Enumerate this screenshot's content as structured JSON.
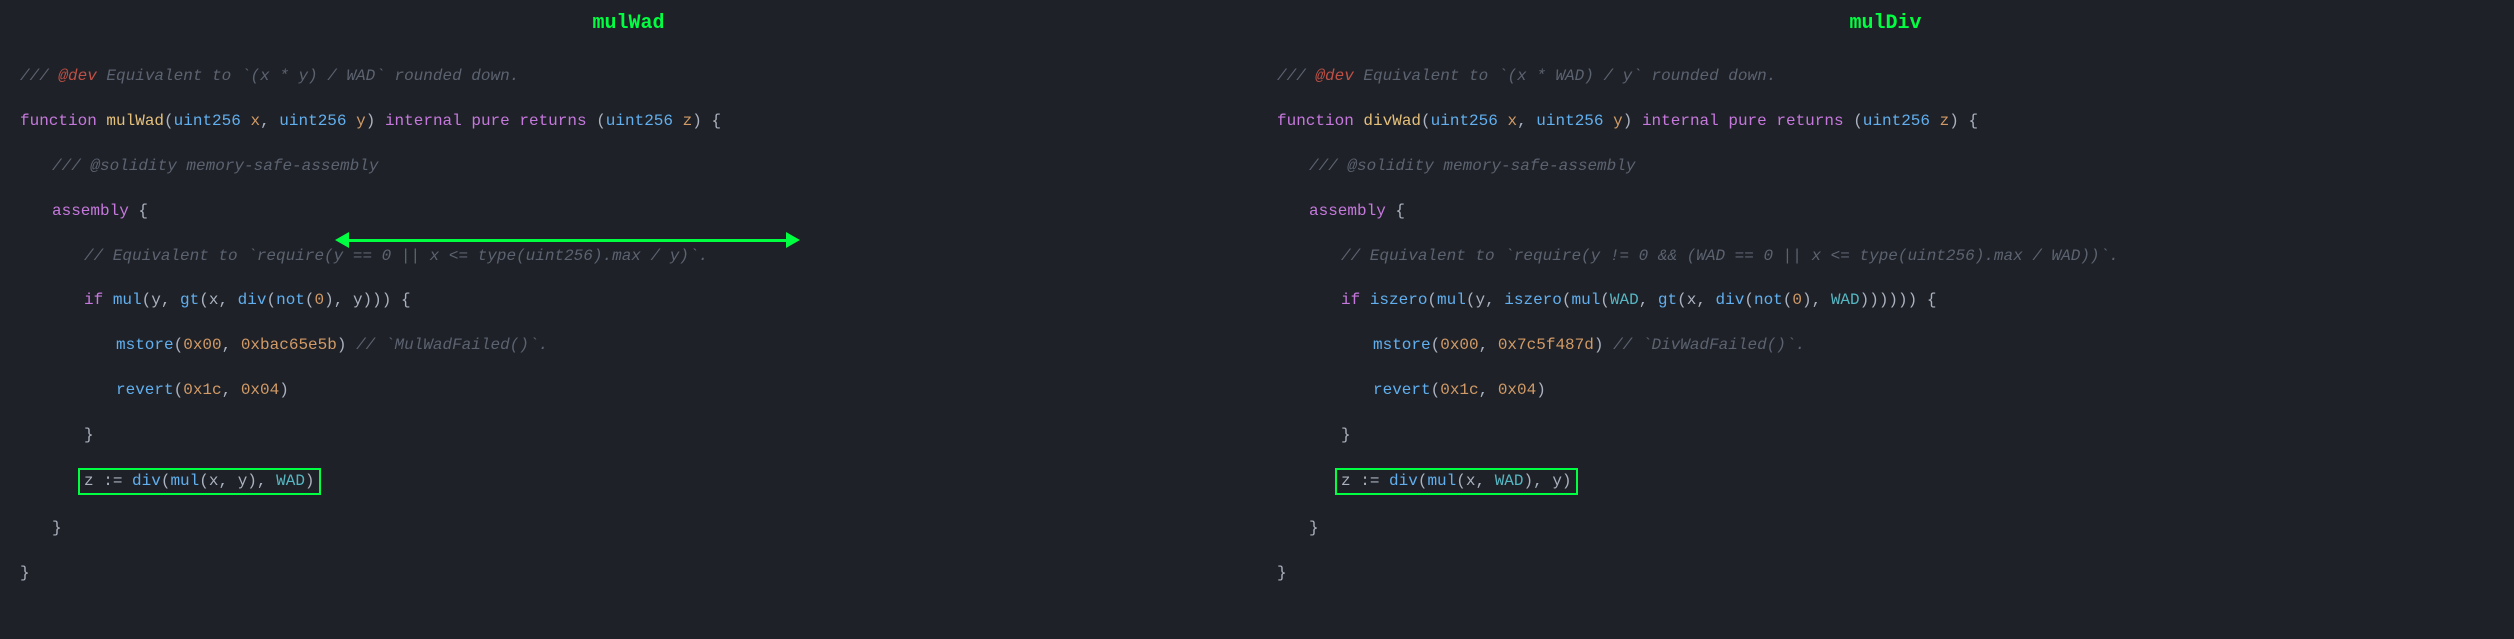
{
  "left": {
    "title": "mulWad",
    "devcomment_prefix": "/// ",
    "devtag": "@dev",
    "devcomment_text": " Equivalent to `(x * y) / WAD` rounded down.",
    "fn_kw": "function",
    "fn_name": "mulWad",
    "param1_type": "uint256",
    "param1_name": "x",
    "param2_type": "uint256",
    "param2_name": "y",
    "modifiers": "internal pure returns",
    "ret_type": "uint256",
    "ret_name": "z",
    "inline_comment1": "/// @solidity memory-safe-assembly",
    "asm_kw": "assembly",
    "require_comment": "// Equivalent to `require(y == 0 || x <= type(uint256).max / y)`.",
    "if_kw": "if",
    "mul_fn": "mul",
    "gt_fn": "gt",
    "div_fn": "div",
    "not_fn": "not",
    "zero": "0",
    "yvar": "y",
    "xvar": "x",
    "mstore_fn": "mstore",
    "mstore_arg1": "0x00",
    "mstore_arg2": "0xbac65e5b",
    "mstore_comment": "// `MulWadFailed()`.",
    "revert_fn": "revert",
    "revert_arg1": "0x1c",
    "revert_arg2": "0x04",
    "assign_var": "z",
    "assign_op": ":=",
    "wad": "WAD"
  },
  "right": {
    "title": "mulDiv",
    "devcomment_prefix": "/// ",
    "devtag": "@dev",
    "devcomment_text": " Equivalent to `(x * WAD) / y` rounded down.",
    "fn_kw": "function",
    "fn_name": "divWad",
    "param1_type": "uint256",
    "param1_name": "x",
    "param2_type": "uint256",
    "param2_name": "y",
    "modifiers": "internal pure returns",
    "ret_type": "uint256",
    "ret_name": "z",
    "inline_comment1": "/// @solidity memory-safe-assembly",
    "asm_kw": "assembly",
    "require_comment": "// Equivalent to `require(y != 0 && (WAD == 0 || x <= type(uint256).max / WAD))`.",
    "if_kw": "if",
    "iszero_fn": "iszero",
    "mul_fn": "mul",
    "gt_fn": "gt",
    "div_fn": "div",
    "not_fn": "not",
    "zero": "0",
    "yvar": "y",
    "xvar": "x",
    "mstore_fn": "mstore",
    "mstore_arg1": "0x00",
    "mstore_arg2": "0x7c5f487d",
    "mstore_comment": "// `DivWadFailed()`.",
    "revert_fn": "revert",
    "revert_arg1": "0x1c",
    "revert_arg2": "0x04",
    "assign_var": "z",
    "assign_op": ":=",
    "wad": "WAD"
  }
}
